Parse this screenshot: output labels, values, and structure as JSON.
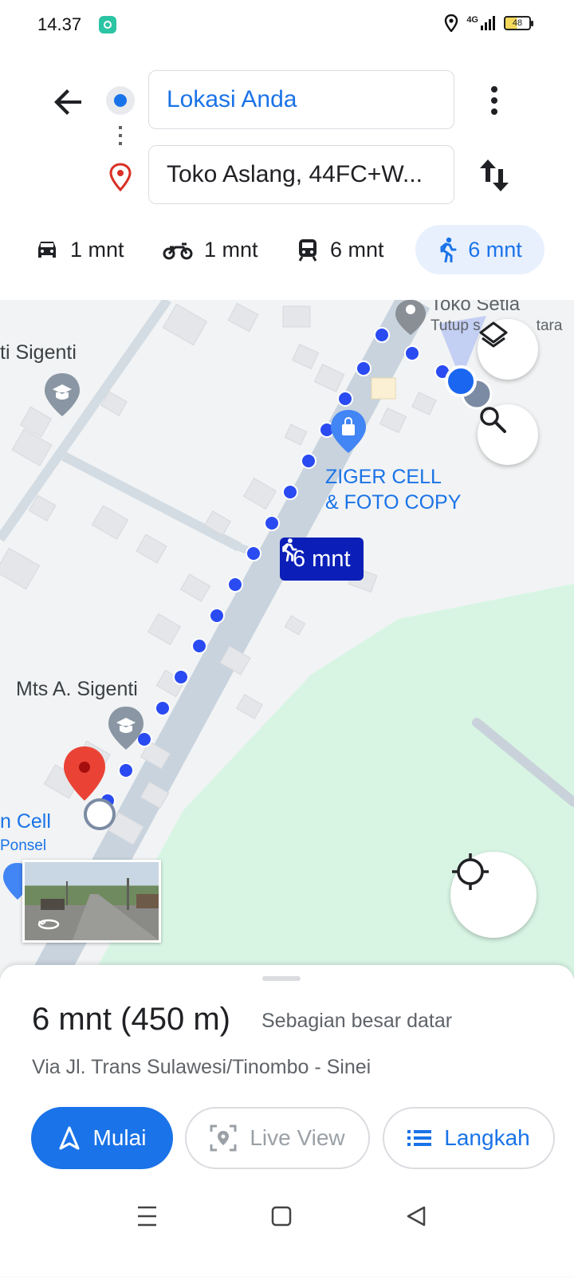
{
  "status_bar": {
    "time": "14.37",
    "network": "4G",
    "battery": "48"
  },
  "header": {
    "origin": "Lokasi Anda",
    "destination": "Toko Aslang, 44FC+W..."
  },
  "modes": [
    {
      "icon": "car-icon",
      "label": "1 mnt",
      "selected": false
    },
    {
      "icon": "motorcycle-icon",
      "label": "1 mnt",
      "selected": false
    },
    {
      "icon": "train-icon",
      "label": "6 mnt",
      "selected": false
    },
    {
      "icon": "walk-icon",
      "label": "6 mnt",
      "selected": true
    }
  ],
  "map": {
    "labels": {
      "sigenti": "ti Sigenti",
      "toko_setia": "Toko Setia",
      "toko_status": "Tutup s",
      "toko_status_tail": "tara",
      "ziger_line1": "ZIGER CELL",
      "ziger_line2": "& FOTO COPY",
      "mts": "Mts A. Sigenti",
      "cell": "n Cell",
      "ponsel": "Ponsel"
    },
    "route_bubble": "6 mnt"
  },
  "summary": {
    "duration_distance": "6 mnt (450 m)",
    "terrain": "Sebagian besar datar",
    "via": "Via Jl. Trans Sulawesi/Tinombo - Sinei"
  },
  "actions": {
    "start": "Mulai",
    "live_view": "Live View",
    "steps": "Langkah"
  },
  "colors": {
    "accent": "#1a73e8",
    "route_dots": "#2a4bf2",
    "park": "#d8f5e4",
    "pin": "#ea4335"
  }
}
